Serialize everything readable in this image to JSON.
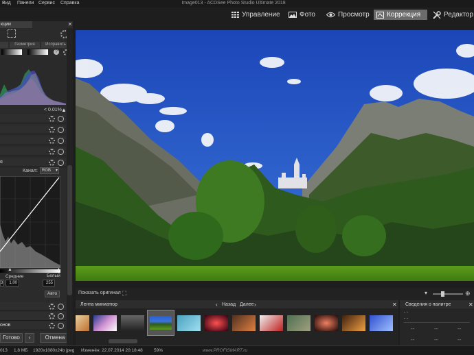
{
  "menu": {
    "items": [
      "Вид",
      "Панели",
      "Сервис",
      "Справка"
    ],
    "window_title": "Image013 - ACDSee Photo Studio Ultimate 2018"
  },
  "modes": {
    "manage": "Управление",
    "photo": "Фото",
    "view": "Просмотр",
    "develop": "Коррекция",
    "edit": "Редактор"
  },
  "left_panel": {
    "title": "кции",
    "tabs": [
      "",
      "Геометрия",
      "Исправить"
    ],
    "clip_percent": "< 0.01%",
    "curve_section_label": "я",
    "channel_label": "Канал:",
    "channel_value": "RGB",
    "midtones_label": "Средние",
    "midtones_value": "1,00",
    "white_label": "Белый",
    "white_value": "255",
    "left_value": "3",
    "auto_button": "Авто",
    "tones_label": "онов",
    "done_button": "Готово",
    "cancel_button": "Отмена"
  },
  "photo_bar": {
    "show_original": "Показать оригинал"
  },
  "filmstrip": {
    "title": "Лента миниатюр",
    "back": "Назад",
    "next": "Далее"
  },
  "palette": {
    "title": "Сведения о палитре",
    "row1": "- -",
    "row2": "- -"
  },
  "status": {
    "filename": "013",
    "size": "1,8 МБ",
    "dimensions": "1920x1080x24b jpeg",
    "modified": "Изменён: 22.07.2014 20:18:48",
    "zoom": "59%",
    "watermark": "www.PROFISMART.ru"
  },
  "colors": {
    "accent_active_mode": "#6b6b6b",
    "sky": "#2a5fd0",
    "panel_bg": "#2b2b2b"
  }
}
